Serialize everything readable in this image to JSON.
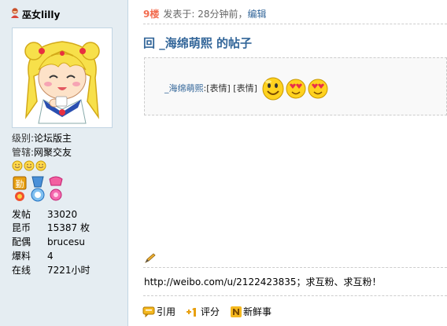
{
  "user": {
    "name": "巫女lilly",
    "icon": "female-user-icon"
  },
  "profile": {
    "level_label": "级别:",
    "level_value": "论坛版主",
    "manage_label": "管辖:",
    "manage_value": "网聚交友",
    "stars": 3,
    "medals": [
      "勤"
    ]
  },
  "stats": [
    {
      "key": "发帖",
      "value": "33020"
    },
    {
      "key": "昆币",
      "value": "15387 枚"
    },
    {
      "key": "配偶",
      "value": "brucesu"
    },
    {
      "key": "爆料",
      "value": "4"
    },
    {
      "key": "在线",
      "value": "7221小时"
    }
  ],
  "post": {
    "floor": "9楼",
    "posted": "发表于: 28分钟前，",
    "edit": "编辑",
    "title": "回 _海绵萌熙 的帖子",
    "quote_author": "_海绵萌熙",
    "quote_text": ":[表情] [表情]",
    "signature": "http://weibo.com/u/2122423835；求互粉、求互粉！"
  },
  "actions": {
    "quote": "引用",
    "rate": "评分",
    "news": "新鲜事"
  }
}
